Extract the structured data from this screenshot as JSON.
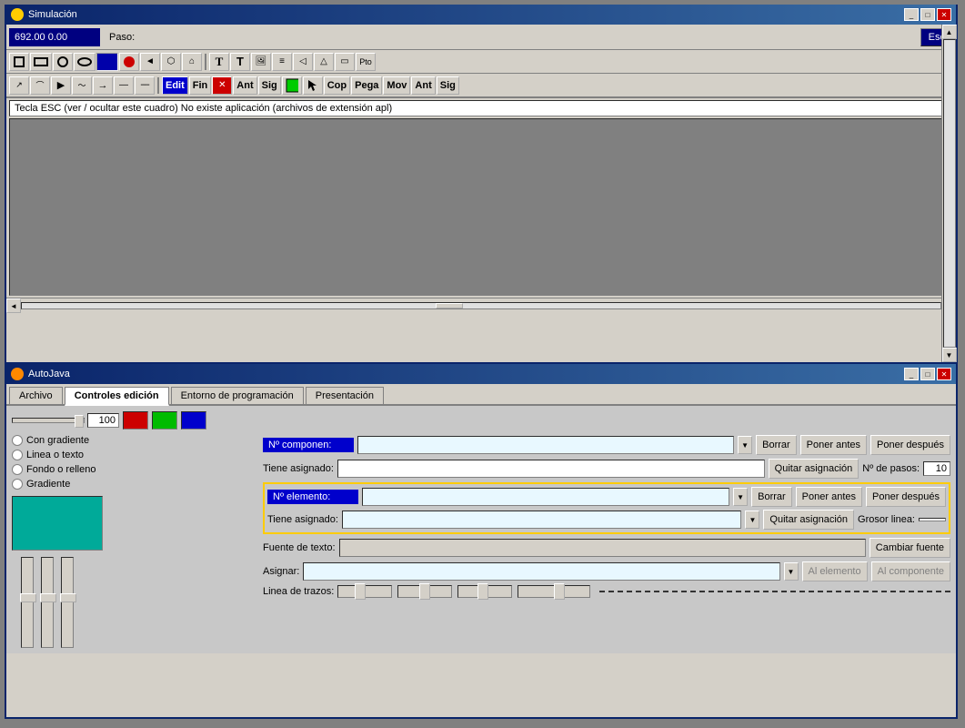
{
  "simulation_window": {
    "title": "Simulación",
    "coords": "692.00  0.00",
    "esc_btn": "Esc",
    "paso_label": "Paso:",
    "status_text": "Tecla ESC (ver / ocultar este cuadro)  No existe aplicación (archivos de extensión apl)",
    "toolbar2_buttons": [
      "□",
      "▭",
      "○",
      "⬭",
      "■",
      "●",
      "◥",
      "🔊",
      "⬡",
      "⌂",
      "T",
      "T",
      "🖼",
      "≡",
      "⟨",
      "△",
      "▭",
      "Pto"
    ],
    "toolbar3_buttons": [
      "↗",
      "⌒",
      "▲",
      "〜",
      "⟶",
      "—",
      "----",
      "Edit",
      "Fin",
      "✕",
      "Ant",
      "Sig",
      "",
      "",
      "Cop",
      "Pega",
      "Mov",
      "Ant",
      "Sig"
    ],
    "title_buttons": [
      "_",
      "□",
      "✕"
    ]
  },
  "autojava_window": {
    "title": "AutoJava",
    "title_buttons": [
      "_",
      "□",
      "✕"
    ],
    "tabs": [
      {
        "label": "Archivo",
        "active": false
      },
      {
        "label": "Controles edición",
        "active": true
      },
      {
        "label": "Entorno de programación",
        "active": false
      },
      {
        "label": "Presentación",
        "active": false
      }
    ],
    "controls": {
      "slider_value": "100",
      "radio_options": [
        "Con gradiente",
        "Linea o texto",
        "Fondo o relleno",
        "Gradiente"
      ],
      "no_componente_label": "Nº componen:",
      "no_componente_placeholder": "",
      "borrar_btn": "Borrar",
      "poner_antes_btn": "Poner antes",
      "poner_despues_btn": "Poner después",
      "tiene_asignado_label": "Tiene asignado:",
      "quitar_asignacion_btn": "Quitar asignación",
      "no_pasos_label": "Nº de pasos:",
      "no_pasos_value": "10",
      "no_elemento_label": "Nº elemento:",
      "borrar_btn2": "Borrar",
      "poner_antes_btn2": "Poner antes",
      "poner_despues_btn2": "Poner después",
      "tiene_asignado_label2": "Tiene asignado:",
      "quitar_asignacion_btn2": "Quitar asignación",
      "grosor_linea_label": "Grosor linea:",
      "fuente_de_texto_label": "Fuente de texto:",
      "cambiar_fuente_btn": "Cambiar fuente",
      "asignar_label": "Asignar:",
      "al_elemento_btn": "Al elemento",
      "al_componente_btn": "Al componente",
      "linea_de_trazos_label": "Linea de trazos:"
    }
  }
}
